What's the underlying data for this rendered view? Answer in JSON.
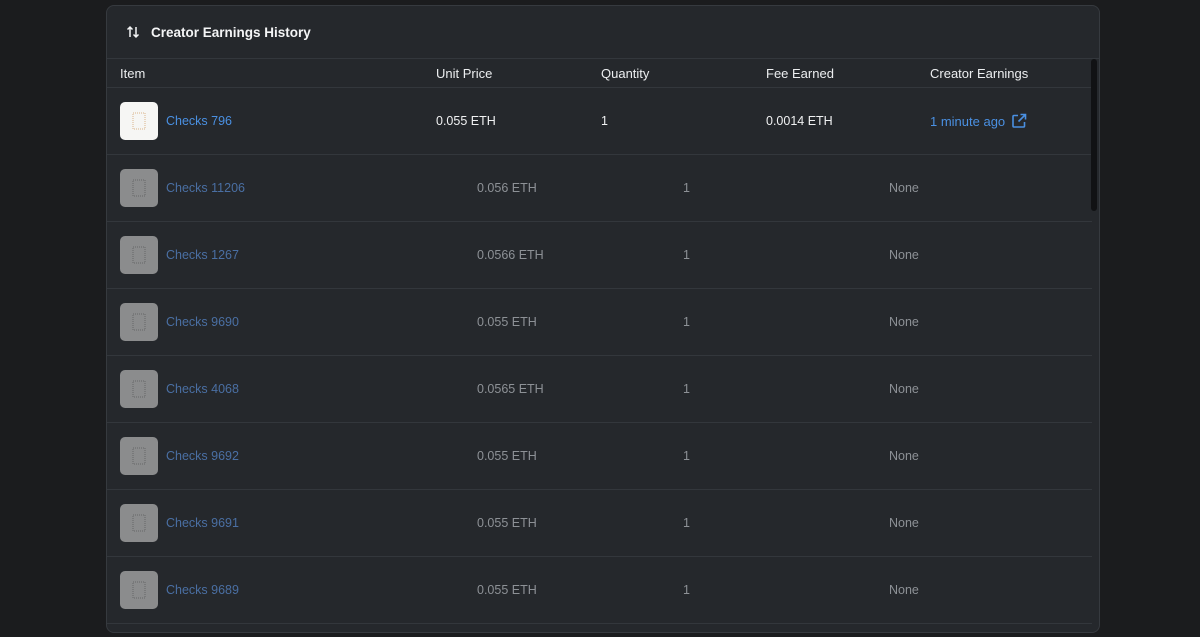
{
  "panel": {
    "title": "Creator Earnings History",
    "header_icon": "swap-vertical-icon"
  },
  "table": {
    "columns": [
      "Item",
      "Unit Price",
      "Quantity",
      "Fee Earned",
      "Creator Earnings"
    ],
    "rows": [
      {
        "item": "Checks 796",
        "price": "0.055 ETH",
        "qty": "1",
        "fee": "0.0014 ETH",
        "earnings": "1 minute ago"
      },
      {
        "item": "Checks 11206",
        "price": "0.056 ETH",
        "qty": "1",
        "fee": "",
        "earnings": "None"
      },
      {
        "item": "Checks 1267",
        "price": "0.0566 ETH",
        "qty": "1",
        "fee": "",
        "earnings": "None"
      },
      {
        "item": "Checks 9690",
        "price": "0.055 ETH",
        "qty": "1",
        "fee": "",
        "earnings": "None"
      },
      {
        "item": "Checks 4068",
        "price": "0.0565 ETH",
        "qty": "1",
        "fee": "",
        "earnings": "None"
      },
      {
        "item": "Checks 9692",
        "price": "0.055 ETH",
        "qty": "1",
        "fee": "",
        "earnings": "None"
      },
      {
        "item": "Checks 9691",
        "price": "0.055 ETH",
        "qty": "1",
        "fee": "",
        "earnings": "None"
      },
      {
        "item": "Checks 9689",
        "price": "0.055 ETH",
        "qty": "1",
        "fee": "",
        "earnings": "None"
      }
    ]
  },
  "colors": {
    "background": "#1b1c1e",
    "panel": "#25282c",
    "link": "#4a90e2"
  }
}
